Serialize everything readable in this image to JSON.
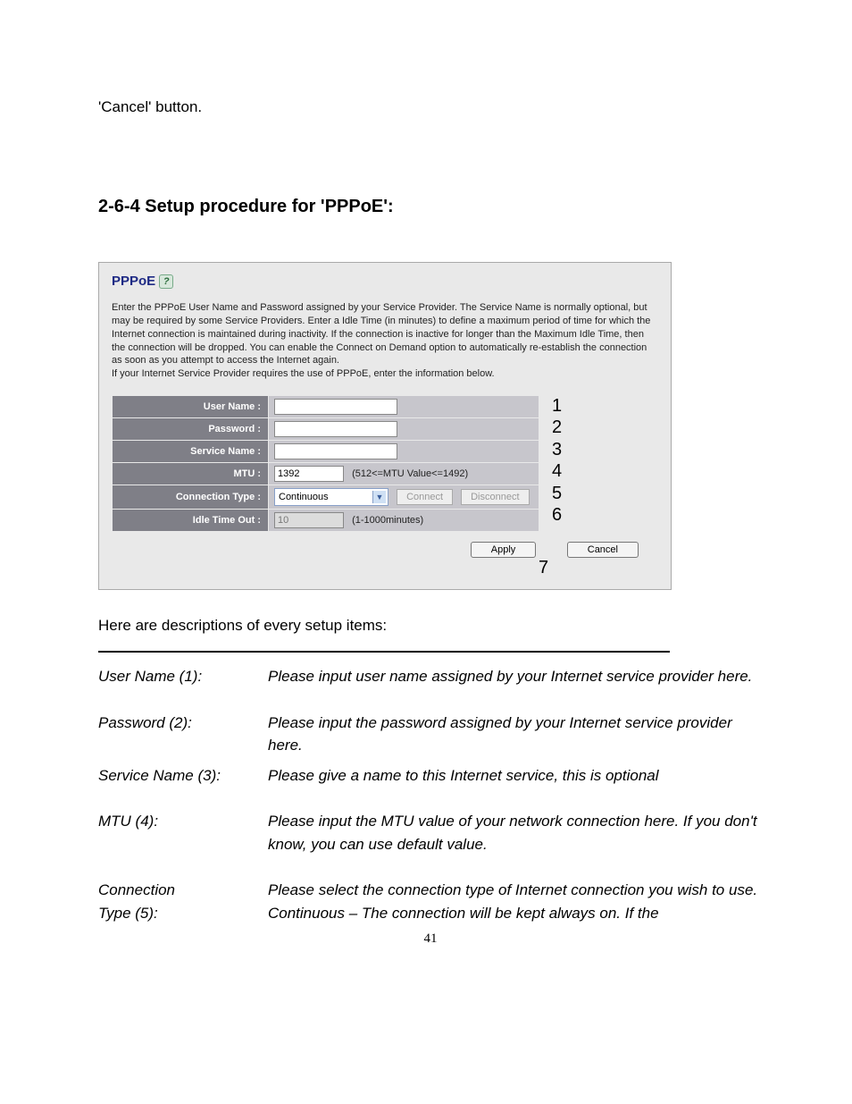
{
  "pre_text": "'Cancel' button.",
  "section_heading": "2-6-4 Setup procedure for 'PPPoE':",
  "router": {
    "title": "PPPoE",
    "help_symbol": "?",
    "description": "Enter the PPPoE User Name and Password assigned by your Service Provider. The Service Name is normally optional, but may be required by some Service Providers. Enter a Idle Time (in minutes) to define a maximum period of time for which the Internet connection is maintained during inactivity. If the connection is inactive for longer than the Maximum Idle Time, then the connection will be dropped. You can enable the Connect on Demand option to automatically re-establish the connection as soon as you attempt to access the Internet again.\nIf your Internet Service Provider requires the use of PPPoE, enter the information below.",
    "labels": {
      "user_name": "User Name :",
      "password": "Password :",
      "service_name": "Service Name :",
      "mtu": "MTU :",
      "connection_type": "Connection Type :",
      "idle_time_out": "Idle Time Out :"
    },
    "values": {
      "user_name": "",
      "password": "",
      "service_name": "",
      "mtu": "1392",
      "connection_type": "Continuous",
      "idle_time_out": "10"
    },
    "hints": {
      "mtu": "(512<=MTU Value<=1492)",
      "idle": "(1-1000minutes)"
    },
    "buttons": {
      "connect": "Connect",
      "disconnect": "Disconnect",
      "apply": "Apply",
      "cancel": "Cancel"
    }
  },
  "callouts": {
    "c1": "1",
    "c2": "2",
    "c3": "3",
    "c4": "4",
    "c5": "5",
    "c6": "6",
    "c7": "7"
  },
  "after_text": "Here are descriptions of every setup items:",
  "descriptions": [
    {
      "term": "User Name (1):",
      "def": "Please input user name assigned by your Internet service provider here."
    },
    {
      "term": "Password (2):",
      "def": "Please input the password assigned by your Internet service provider here."
    },
    {
      "term": "Service Name (3):",
      "def": "Please give a name to this Internet service, this is optional"
    },
    {
      "term": "MTU (4):",
      "def": "Please input the MTU value of your network connection here. If you don't know, you can use default value."
    },
    {
      "term": "Connection\nType (5):",
      "def": "Please select the connection type of Internet connection you wish to use.\nContinuous – The connection will be kept always on. If the"
    }
  ],
  "page_number": "41"
}
